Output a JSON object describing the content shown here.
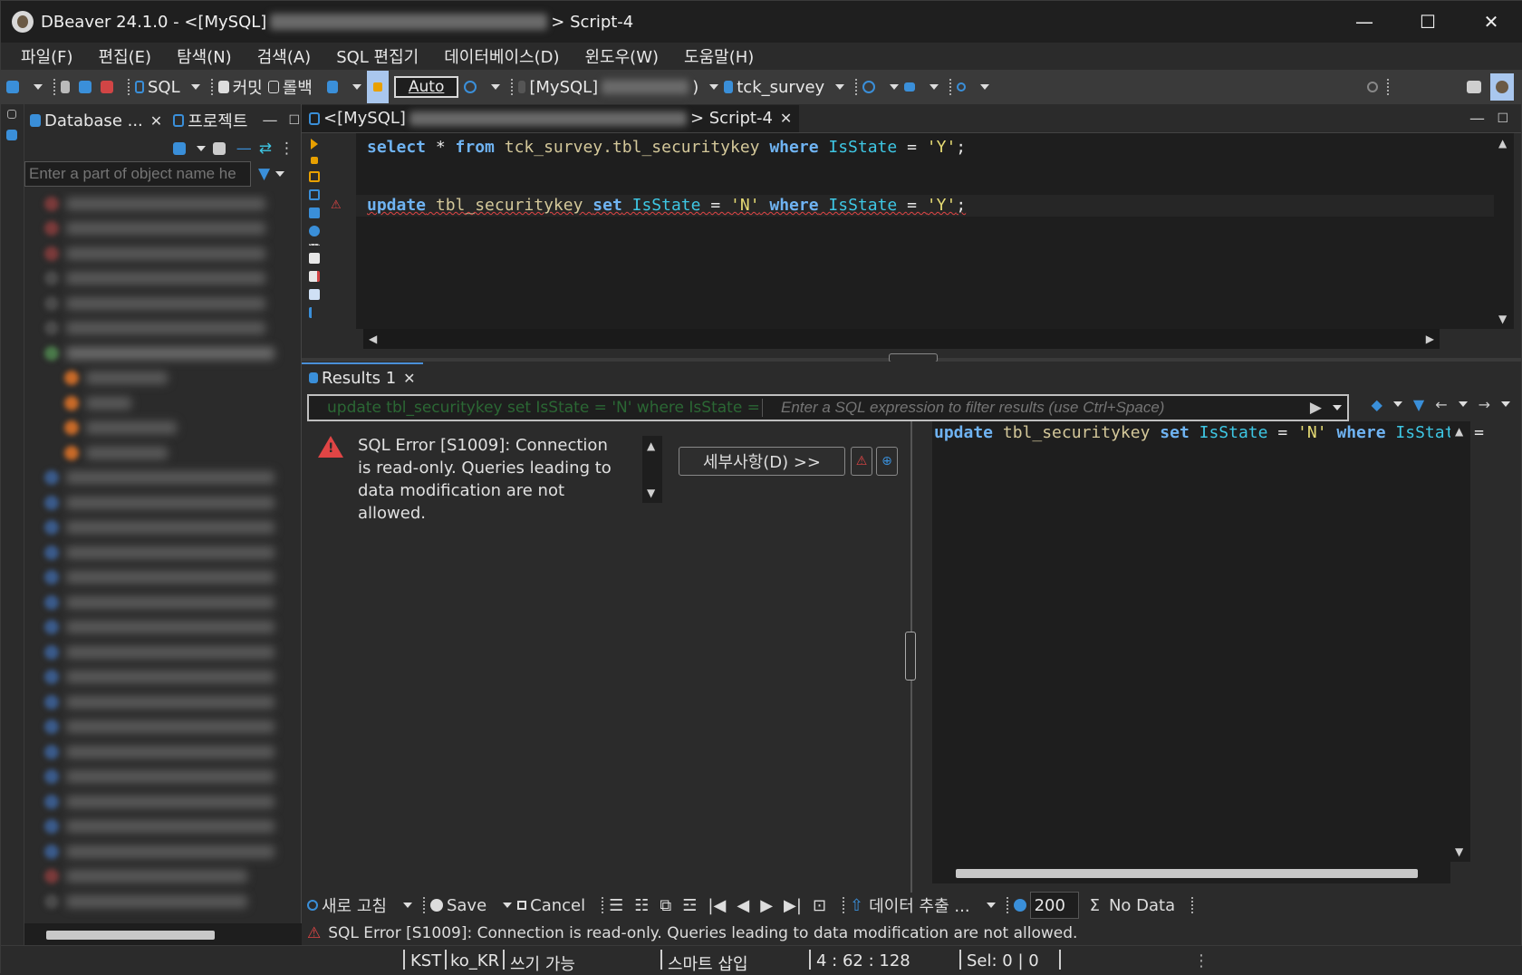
{
  "window": {
    "title_prefix": "DBeaver 24.1.0 - <[MySQL]",
    "title_suffix": "> Script-4",
    "minimize": "—",
    "maximize": "☐",
    "close": "✕"
  },
  "menu": [
    "파일(F)",
    "편집(E)",
    "탐색(N)",
    "검색(A)",
    "SQL 편집기",
    "데이터베이스(D)",
    "윈도우(W)",
    "도움말(H)"
  ],
  "toolbar": {
    "sql_label": "SQL",
    "commit_label": "커밋",
    "rollback_label": "롤백",
    "auto_label": "Auto",
    "connection_label": "[MySQL]",
    "connection_suffix": ")",
    "schema_label": "tck_survey"
  },
  "left_panel": {
    "tab_database": "Database ...",
    "tab_project": "프로젝트",
    "filter_placeholder": "Enter a part of object name he"
  },
  "editor": {
    "tab_prefix": "<[MySQL]",
    "tab_suffix": "> Script-4",
    "line1": {
      "kw1": "select",
      "op1": " * ",
      "kw2": "from",
      "id1": " tck_survey.tbl_securitykey ",
      "kw3": "where",
      "col1": " IsState ",
      "op2": "= ",
      "str1": "'Y'",
      "op3": ";"
    },
    "line2": {
      "kw1": "update",
      "id1": " tbl_securitykey ",
      "kw2": "set",
      "col1": " IsState ",
      "op1": "= ",
      "str1": "'N'",
      "kw3": " where",
      "col2": " IsState ",
      "op2": "= ",
      "str2": "'Y'",
      "op3": ";"
    }
  },
  "results": {
    "tab_label": "Results 1",
    "filter_history": "update tbl_securitykey set IsState = 'N' where IsState = 'Y'",
    "filter_placeholder": "Enter a SQL expression to filter results (use Ctrl+Space)",
    "error_message": "SQL Error [S1009]: Connection is read-only. Queries leading to data modification are not allowed.",
    "details_button": "세부사항(D) >>",
    "preview": {
      "kw1": "update",
      "id1": " tbl_securitykey ",
      "kw2": "set",
      "col1": " IsState ",
      "op1": "= ",
      "str1": "'N'",
      "kw3": " where",
      "col2": " IsState ",
      "op2": "="
    },
    "refresh_label": "새로 고침",
    "save_label": "Save",
    "cancel_label": "Cancel",
    "export_label": "데이터 추출 ...",
    "fetch_size": "200",
    "no_data_label": "No Data",
    "status_message": "SQL Error [S1009]: Connection is read-only. Queries leading to data modification are not allowed."
  },
  "statusbar": {
    "timezone": "KST",
    "locale": "ko_KR",
    "write_mode": "쓰기 가능",
    "insert_mode": "스마트 삽입",
    "position": "4 : 62 : 128",
    "selection": "Sel: 0 | 0"
  },
  "colors": {
    "keyword": "#6fb3f2",
    "identifier": "#d4c89a",
    "column": "#3ec7e4",
    "string": "#e6db74",
    "error": "#e04545",
    "accent": "#4a90d9"
  }
}
